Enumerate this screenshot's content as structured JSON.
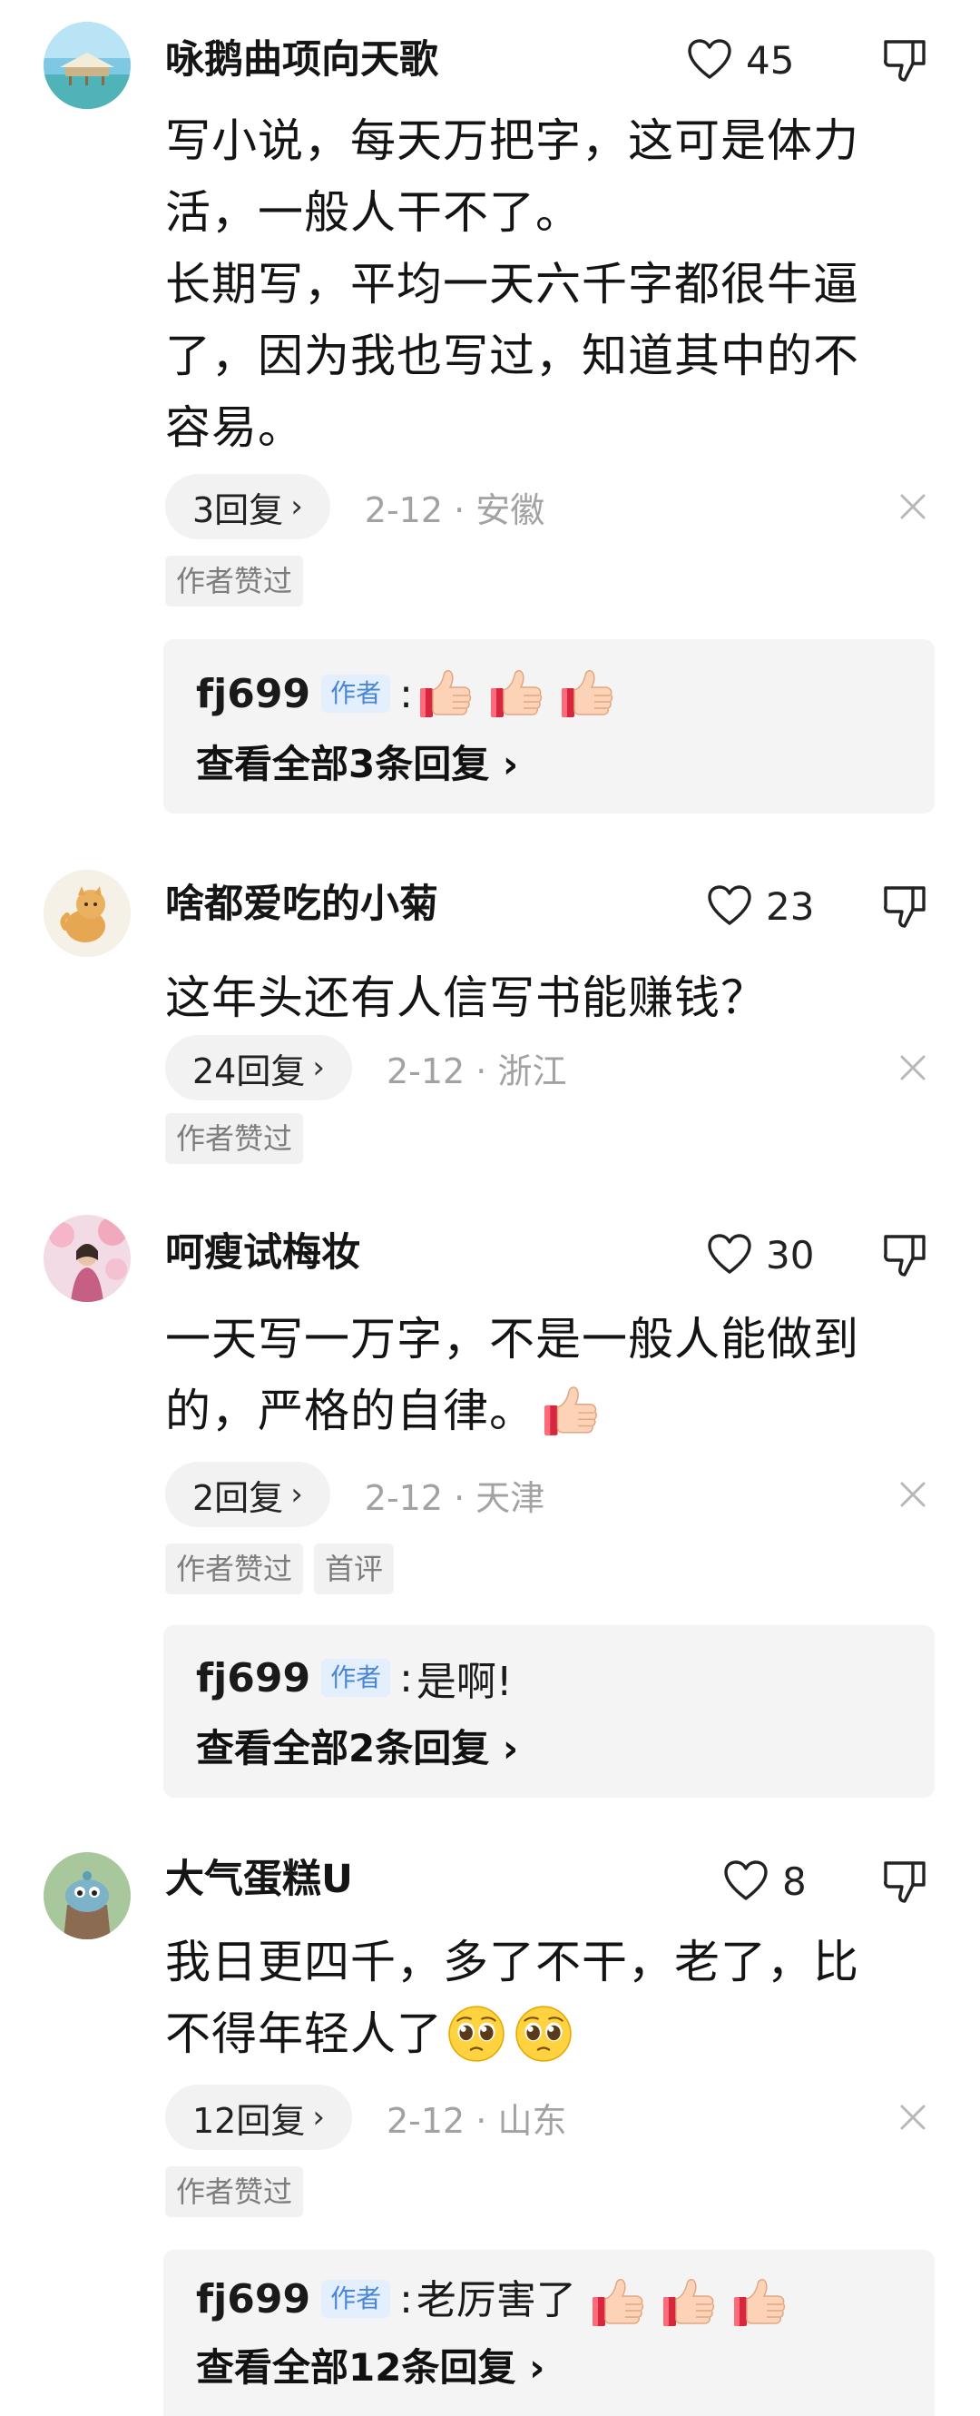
{
  "colors": {
    "author_badge_bg": "#e3effc",
    "author_badge_text": "#4a86d6",
    "meta_text": "#a2a2a2",
    "reply_box_bg": "#f4f4f4"
  },
  "comments": [
    {
      "username": "咏鹅曲项向天歌",
      "likes": "45",
      "text_lines": [
        "写小说，每天万把字，这可是体力",
        "活，一般人干不了。",
        "长期写，平均一天六千字都很牛逼",
        "了，因为我也写过，知道其中的不",
        "容易。"
      ],
      "replies_label": "3回复",
      "date_loc": "2-12 · 安徽",
      "tags": [
        "作者赞过"
      ],
      "reply": {
        "author": "fj699",
        "badge": "作者",
        "content": "",
        "emojis": [
          "thumbs-up",
          "thumbs-up",
          "thumbs-up"
        ],
        "view_all": "查看全部3条回复"
      }
    },
    {
      "username": "啥都爱吃的小菊",
      "likes": "23",
      "text_lines": [
        "这年头还有人信写书能赚钱？"
      ],
      "replies_label": "24回复",
      "date_loc": "2-12 · 浙江",
      "tags": [
        "作者赞过"
      ]
    },
    {
      "username": "呵瘦试梅妆",
      "likes": "30",
      "text_lines": [
        "一天写一万字，不是一般人能做到",
        "的，严格的自律。"
      ],
      "text_emojis": [
        "thumbs-up"
      ],
      "replies_label": "2回复",
      "date_loc": "2-12 · 天津",
      "tags": [
        "作者赞过",
        "首评"
      ],
      "reply": {
        "author": "fj699",
        "badge": "作者",
        "content": "是啊!",
        "view_all": "查看全部2条回复"
      }
    },
    {
      "username": "大气蛋糕U",
      "likes": "8",
      "text_lines": [
        "我日更四千，多了不干，老了，比",
        "不得年轻人了"
      ],
      "text_emojis": [
        "pleading-face",
        "pleading-face"
      ],
      "replies_label": "12回复",
      "date_loc": "2-12 · 山东",
      "tags": [
        "作者赞过"
      ],
      "reply": {
        "author": "fj699",
        "badge": "作者",
        "content": "老厉害了",
        "emojis": [
          "thumbs-up",
          "thumbs-up",
          "thumbs-up"
        ],
        "view_all": "查看全部12条回复"
      }
    }
  ]
}
